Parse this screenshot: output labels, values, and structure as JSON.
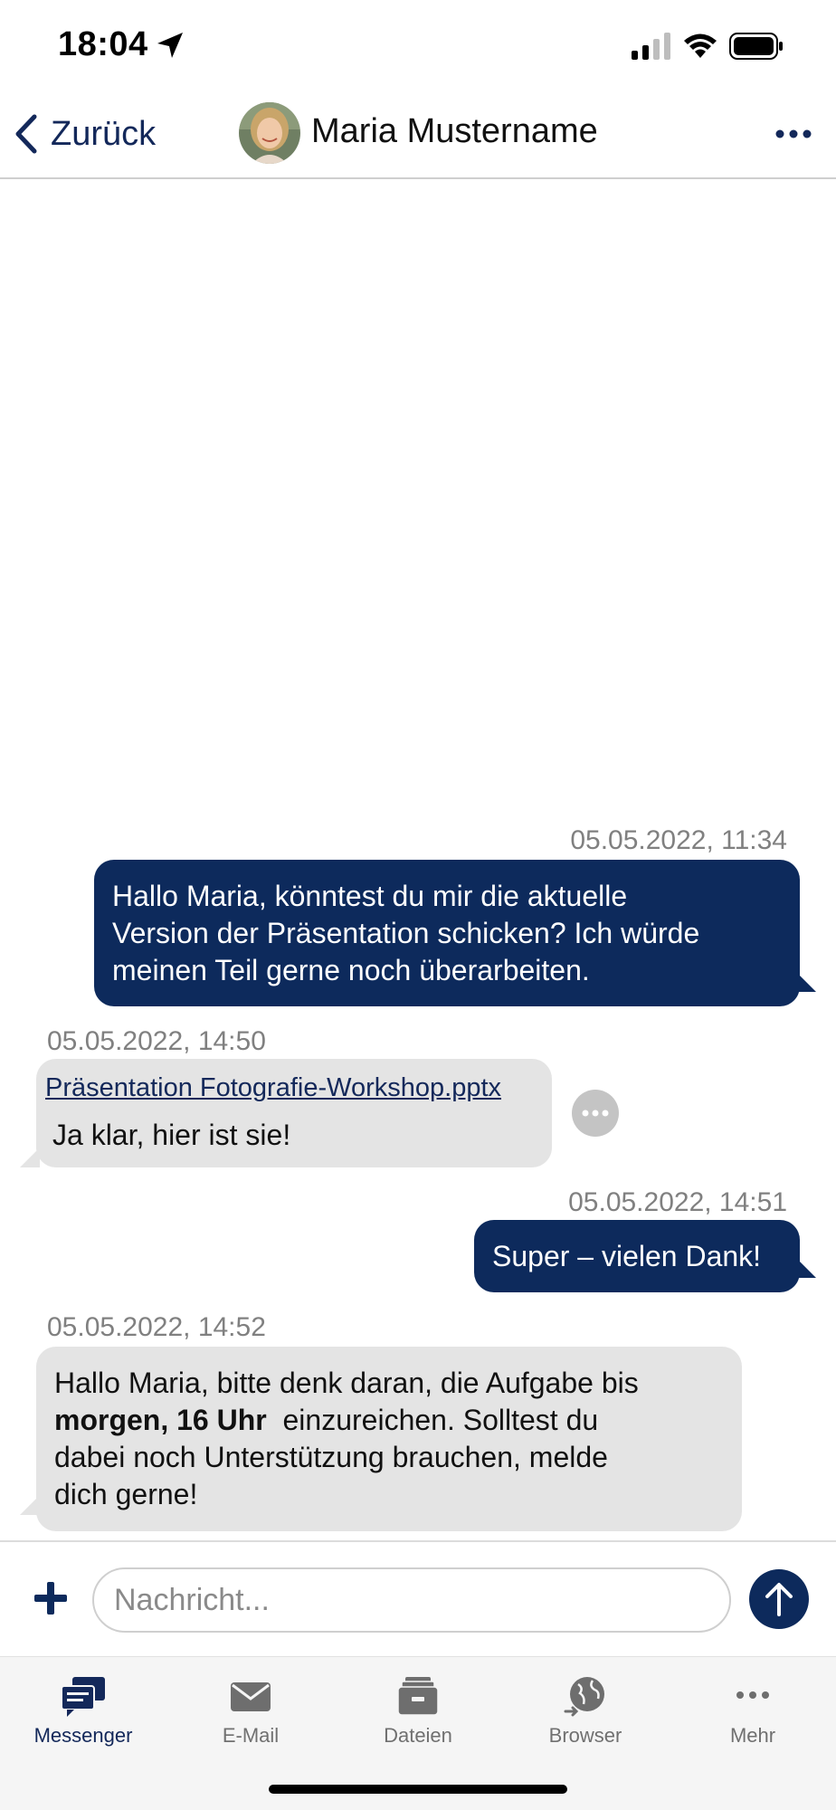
{
  "status_bar": {
    "time": "18:04"
  },
  "header": {
    "back_label": "Zurück",
    "contact_name": "Maria Mustername"
  },
  "messages": [
    {
      "direction": "outgoing",
      "timestamp": "05.05.2022, 11:34",
      "lines": [
        "Hallo Maria, könntest du mir die aktuelle",
        "Version der Präsentation schicken? Ich würde",
        "meinen Teil gerne noch überarbeiten."
      ]
    },
    {
      "direction": "incoming",
      "timestamp": "05.05.2022, 14:50",
      "attachment": "Präsentation Fotografie-Workshop.pptx",
      "text": "Ja klar, hier ist sie!"
    },
    {
      "direction": "outgoing",
      "timestamp": "05.05.2022, 14:51",
      "text": "Super – vielen Dank!"
    },
    {
      "direction": "incoming",
      "timestamp": "05.05.2022, 14:52",
      "line1": "Hallo Maria, bitte denk daran, die Aufgabe bis",
      "bold": "morgen, 16 Uhr",
      "line2_rest": "einzureichen. Solltest du",
      "line3": "dabei noch Unterstützung brauchen, melde",
      "line4": "dich gerne!"
    }
  ],
  "composer": {
    "placeholder": "Nachricht..."
  },
  "tabs": [
    {
      "label": "Messenger",
      "icon": "messenger-icon",
      "active": true
    },
    {
      "label": "E-Mail",
      "icon": "mail-icon",
      "active": false
    },
    {
      "label": "Dateien",
      "icon": "files-icon",
      "active": false
    },
    {
      "label": "Browser",
      "icon": "globe-icon",
      "active": false
    },
    {
      "label": "Mehr",
      "icon": "more-icon",
      "active": false
    }
  ],
  "colors": {
    "accent": "#0d2a5c",
    "incoming_bubble": "#e4e4e4",
    "link": "#13285a"
  }
}
